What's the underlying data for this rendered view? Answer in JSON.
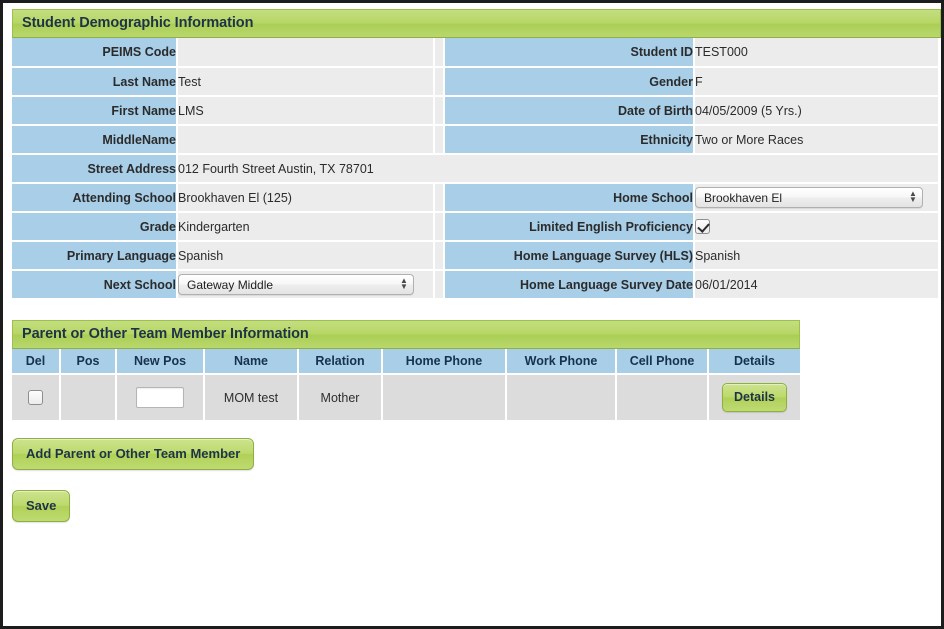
{
  "demographic": {
    "section_title": "Student Demographic Information",
    "rows": [
      {
        "left_label": "PEIMS Code",
        "left_value": "",
        "left_type": "text",
        "right_label": "Student ID",
        "right_value": "TEST000",
        "right_type": "text"
      },
      {
        "left_label": "Last Name",
        "left_value": "Test",
        "left_type": "text",
        "right_label": "Gender",
        "right_value": "F",
        "right_type": "text"
      },
      {
        "left_label": "First Name",
        "left_value": "LMS",
        "left_type": "text",
        "right_label": "Date of Birth",
        "right_value": "04/05/2009 (5 Yrs.)",
        "right_type": "text"
      },
      {
        "left_label": "MiddleName",
        "left_value": "",
        "left_type": "text",
        "right_label": "Ethnicity",
        "right_value": "Two or More Races",
        "right_type": "text"
      }
    ],
    "street_address": {
      "label": "Street Address",
      "value": "012 Fourth Street Austin, TX 78701"
    },
    "rows2": [
      {
        "left_label": "Attending School",
        "left_value": "Brookhaven El (125)",
        "left_type": "text",
        "right_label": "Home School",
        "right_value": "Brookhaven El",
        "right_type": "select"
      },
      {
        "left_label": "Grade",
        "left_value": "Kindergarten",
        "left_type": "text",
        "right_label": "Limited English Proficiency",
        "right_value": "",
        "right_type": "checkbox",
        "right_checked": true
      },
      {
        "left_label": "Primary Language",
        "left_value": "Spanish",
        "left_type": "text",
        "right_label": "Home Language Survey (HLS)",
        "right_value": "Spanish",
        "right_type": "text"
      },
      {
        "left_label": "Next School",
        "left_value": "Gateway Middle",
        "left_type": "select",
        "right_label": "Home Language Survey Date",
        "right_value": "06/01/2014",
        "right_type": "text"
      }
    ]
  },
  "parent": {
    "section_title": "Parent or Other Team Member Information",
    "columns": [
      "Del",
      "Pos",
      "New Pos",
      "Name",
      "Relation",
      "Home Phone",
      "Work Phone",
      "Cell Phone",
      "Details"
    ],
    "rows": [
      {
        "del_checked": false,
        "pos": "",
        "new_pos": "",
        "name": "MOM test",
        "relation": "Mother",
        "home_phone": "",
        "work_phone": "",
        "cell_phone": "",
        "details_label": "Details"
      }
    ],
    "add_button_label": "Add Parent or Other Team Member"
  },
  "footer": {
    "save_button_label": "Save"
  },
  "colors": {
    "header_green": "#b6d663",
    "label_blue": "#a8cee8",
    "label_text": "#16324d",
    "value_grey": "#ececec",
    "row_grey": "#dcdcdc",
    "button_green": "#bcd96c"
  }
}
